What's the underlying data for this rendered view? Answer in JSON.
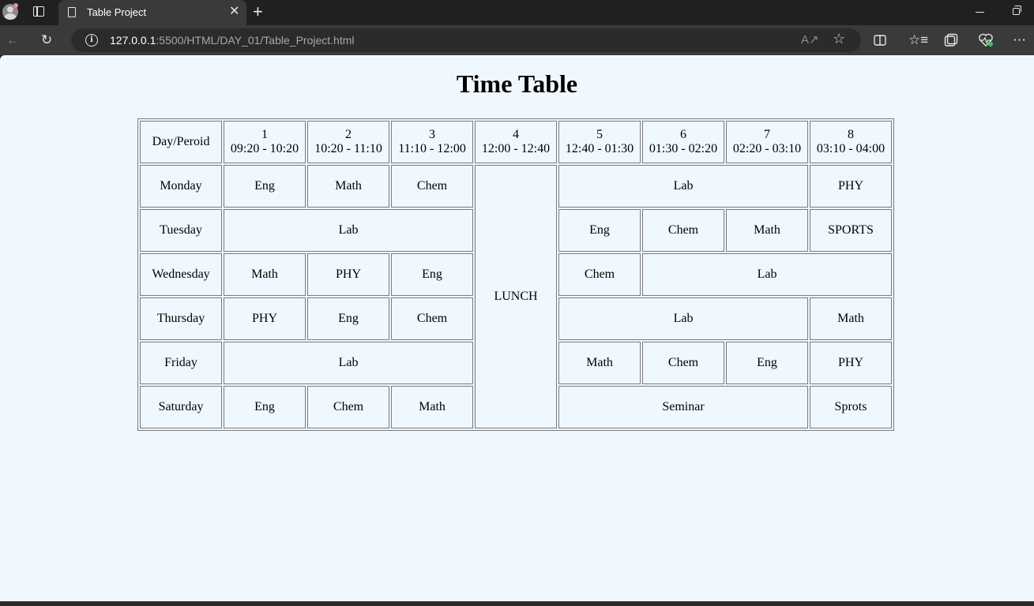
{
  "browser": {
    "tab_title": "Table Project",
    "tab_close": "✕",
    "new_tab": "+",
    "url_host": "127.0.0.1",
    "url_path": ":5500/HTML/DAY_01/Table_Project.html",
    "icons": [
      "back-icon",
      "refresh-icon",
      "site-info-icon",
      "read-aloud-icon",
      "favorite-star-icon",
      "split-screen-icon",
      "favorites-icon",
      "collections-icon",
      "browser-essentials-icon",
      "more-options-icon"
    ]
  },
  "page": {
    "title": "Time Table"
  },
  "table": {
    "header": {
      "day_label": "Day/Peroid",
      "periods": [
        {
          "num": "1",
          "time": "09:20 - 10:20"
        },
        {
          "num": "2",
          "time": "10:20 - 11:10"
        },
        {
          "num": "3",
          "time": "11:10 - 12:00"
        },
        {
          "num": "4",
          "time": "12:00 - 12:40"
        },
        {
          "num": "5",
          "time": "12:40 - 01:30"
        },
        {
          "num": "6",
          "time": "01:30 - 02:20"
        },
        {
          "num": "7",
          "time": "02:20 - 03:10"
        },
        {
          "num": "8",
          "time": "03:10 - 04:00"
        }
      ]
    },
    "lunch": "LUNCH",
    "rows": [
      {
        "day": "Monday",
        "cells": [
          {
            "text": "Eng",
            "span": 1
          },
          {
            "text": "Math",
            "span": 1
          },
          {
            "text": "Chem",
            "span": 1
          },
          {
            "lunch": true
          },
          {
            "text": "Lab",
            "span": 3
          },
          {
            "text": "PHY",
            "span": 1
          }
        ]
      },
      {
        "day": "Tuesday",
        "cells": [
          {
            "text": "Lab",
            "span": 3
          },
          {
            "text": "Eng",
            "span": 1
          },
          {
            "text": "Chem",
            "span": 1
          },
          {
            "text": "Math",
            "span": 1
          },
          {
            "text": "SPORTS",
            "span": 1
          }
        ]
      },
      {
        "day": "Wednesday",
        "cells": [
          {
            "text": "Math",
            "span": 1
          },
          {
            "text": "PHY",
            "span": 1
          },
          {
            "text": "Eng",
            "span": 1
          },
          {
            "text": "Chem",
            "span": 1
          },
          {
            "text": "Lab",
            "span": 3
          }
        ]
      },
      {
        "day": "Thursday",
        "cells": [
          {
            "text": "PHY",
            "span": 1
          },
          {
            "text": "Eng",
            "span": 1
          },
          {
            "text": "Chem",
            "span": 1
          },
          {
            "text": "Lab",
            "span": 3
          },
          {
            "text": "Math",
            "span": 1
          }
        ]
      },
      {
        "day": "Friday",
        "cells": [
          {
            "text": "Lab",
            "span": 3
          },
          {
            "text": "Math",
            "span": 1
          },
          {
            "text": "Chem",
            "span": 1
          },
          {
            "text": "Eng",
            "span": 1
          },
          {
            "text": "PHY",
            "span": 1
          }
        ]
      },
      {
        "day": "Saturday",
        "cells": [
          {
            "text": "Eng",
            "span": 1
          },
          {
            "text": "Chem",
            "span": 1
          },
          {
            "text": "Math",
            "span": 1
          },
          {
            "text": "Seminar",
            "span": 3
          },
          {
            "text": "Sprots",
            "span": 1
          }
        ]
      }
    ]
  }
}
